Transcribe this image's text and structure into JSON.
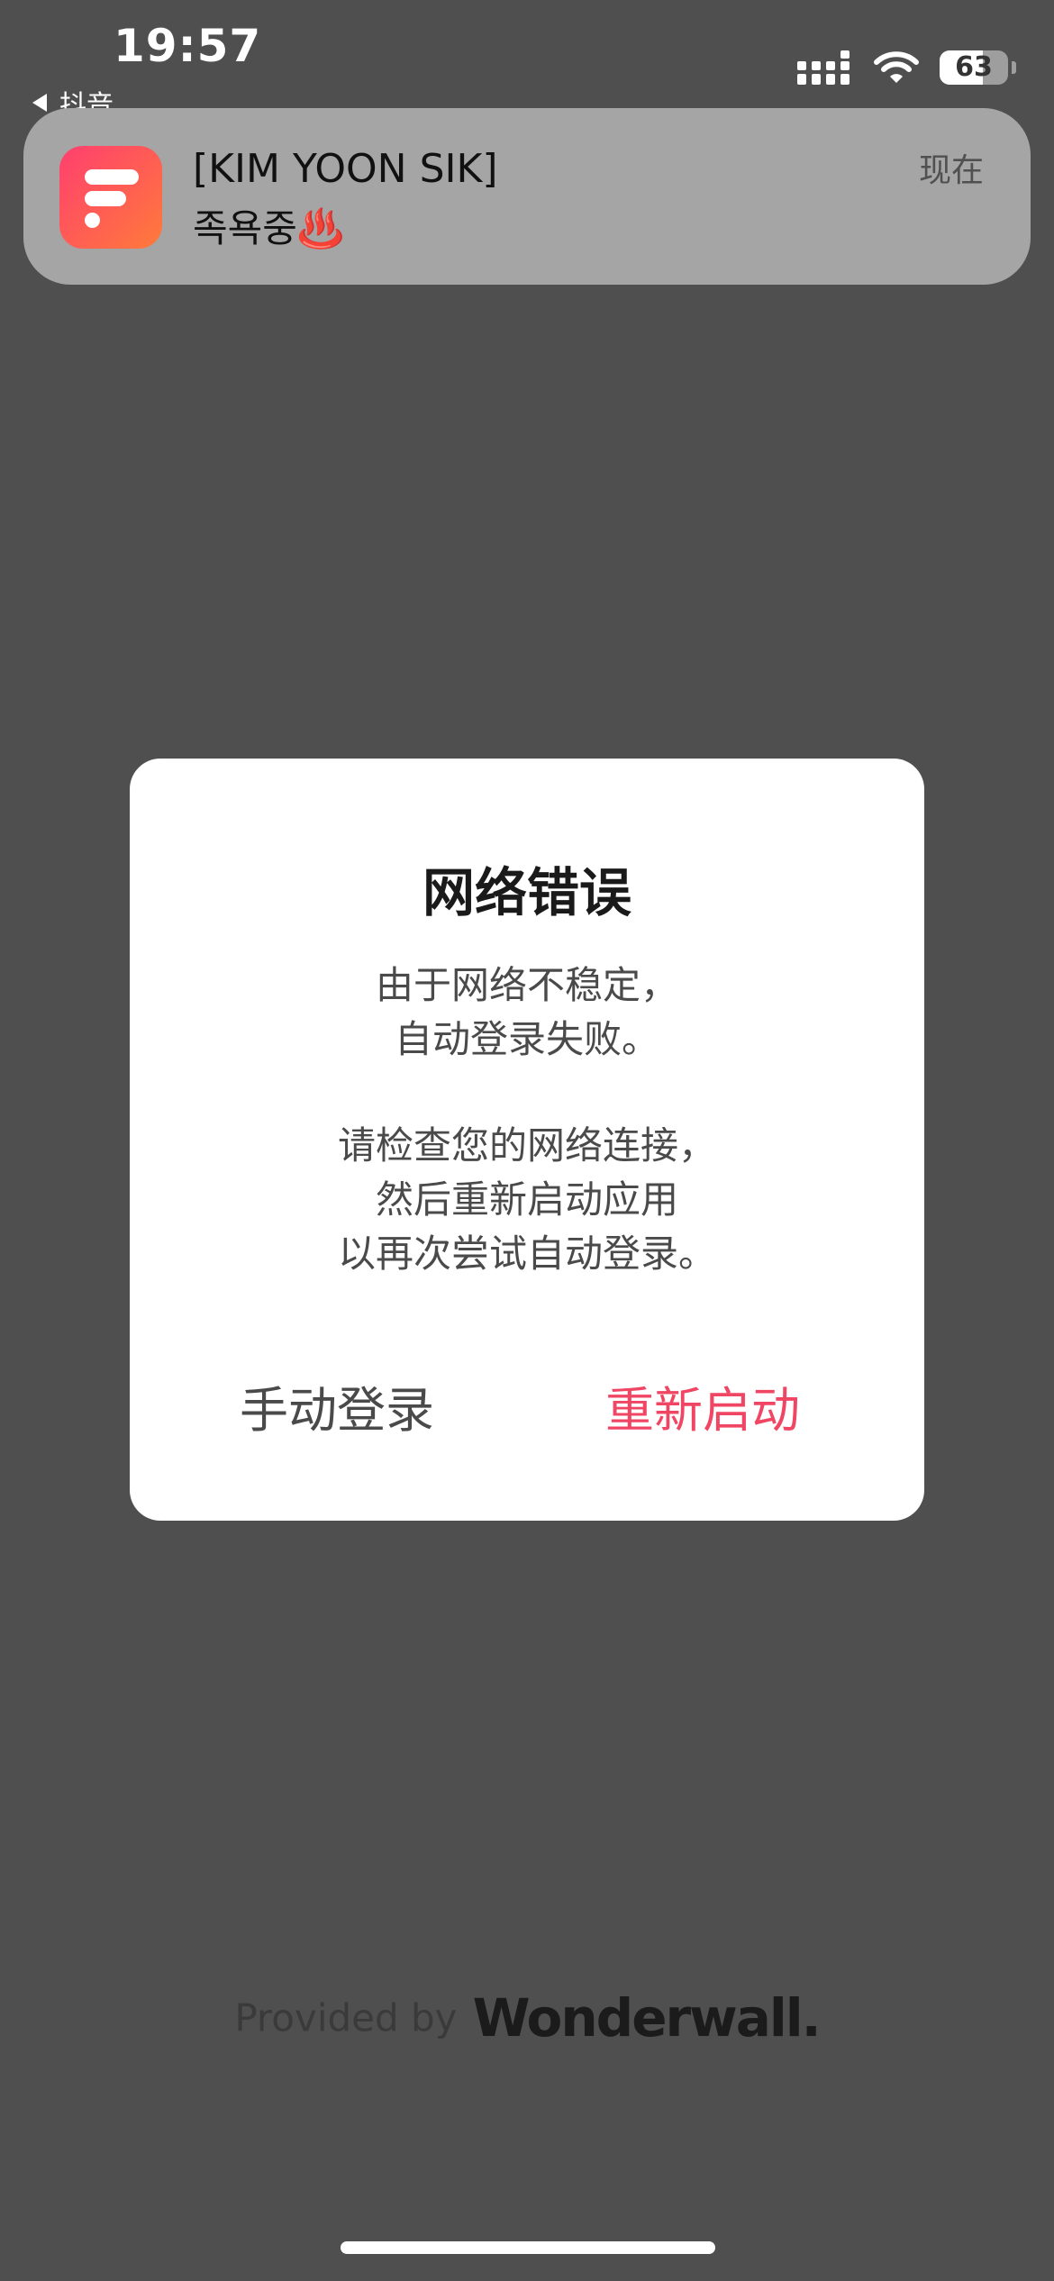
{
  "status_bar": {
    "time": "19:57",
    "back_app": "抖音",
    "battery_percent": 63,
    "battery_text": "63"
  },
  "notification": {
    "title": "[KIM YOON SIK]",
    "body": "족욕중♨️",
    "time": "现在",
    "icon_colors": [
      "#ff3f6f",
      "#ff7a3a"
    ]
  },
  "dialog": {
    "title": "网络错误",
    "message1": [
      "由于网络不稳定，",
      "自动登录失败。"
    ],
    "message2": [
      "请检查您的网络连接，",
      "然后重新启动应用",
      "以再次尝试自动登录。"
    ],
    "manual_login_label": "手动登录",
    "restart_label": "重新启动",
    "restart_color": "#f04664"
  },
  "footer": {
    "provided_by": "Provided by",
    "brand": "Wonderwall."
  }
}
